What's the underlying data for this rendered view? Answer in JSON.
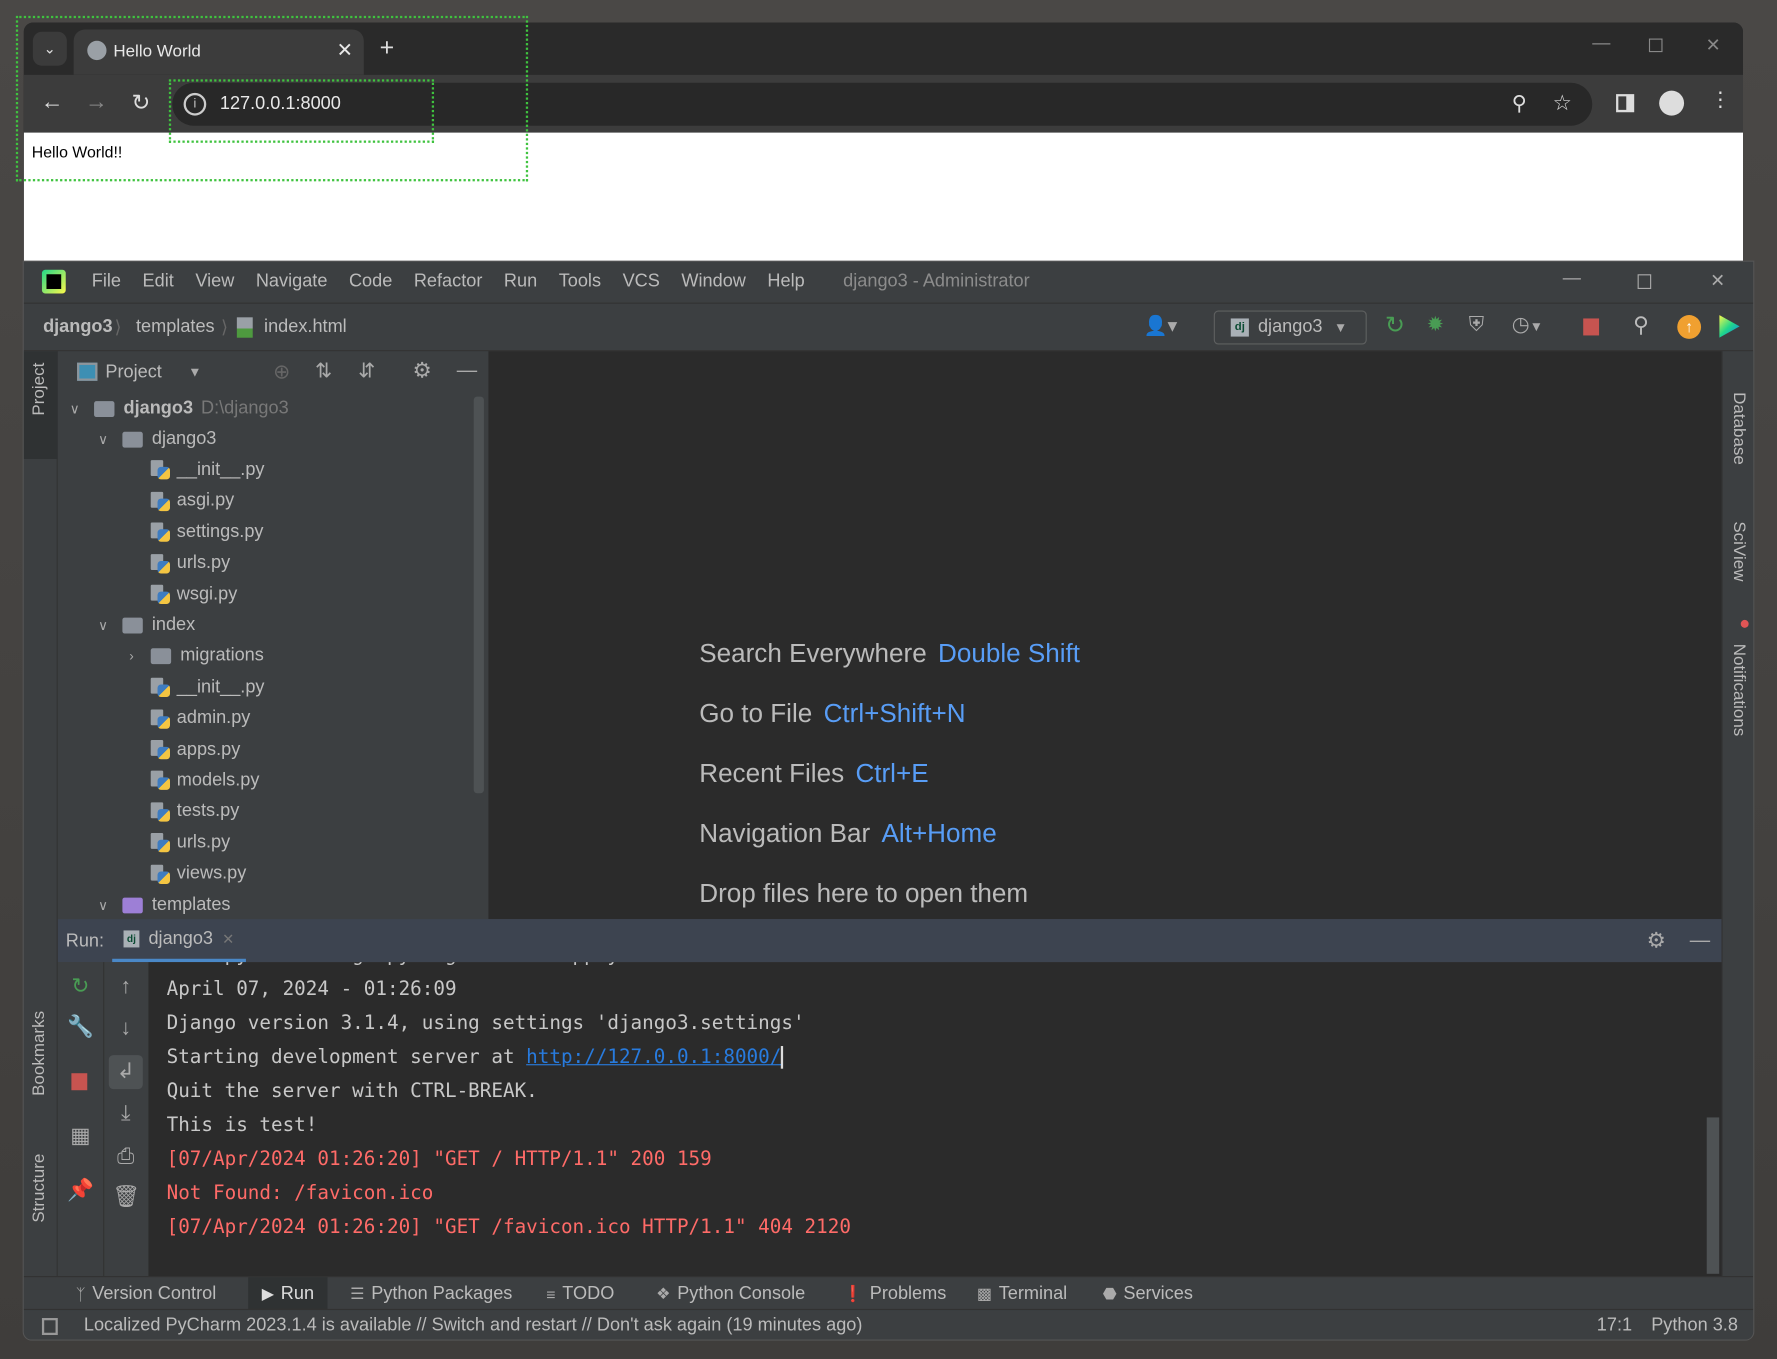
{
  "browser": {
    "tab_title": "Hello World",
    "url": "127.0.0.1:8000",
    "page_text": "Hello World!!"
  },
  "ide": {
    "menu": [
      "File",
      "Edit",
      "View",
      "Navigate",
      "Code",
      "Refactor",
      "Run",
      "Tools",
      "VCS",
      "Window",
      "Help"
    ],
    "window_title": "django3 - Administrator",
    "breadcrumb": [
      "django3",
      "templates",
      "index.html"
    ],
    "run_config": "django3",
    "project_panel": {
      "title": "Project",
      "root": {
        "name": "django3",
        "path": "D:\\django3"
      },
      "tree": [
        {
          "label": "django3",
          "type": "folder",
          "level": 1,
          "expanded": true
        },
        {
          "label": "__init__.py",
          "type": "py",
          "level": 2
        },
        {
          "label": "asgi.py",
          "type": "py",
          "level": 2
        },
        {
          "label": "settings.py",
          "type": "py",
          "level": 2
        },
        {
          "label": "urls.py",
          "type": "py",
          "level": 2
        },
        {
          "label": "wsgi.py",
          "type": "py",
          "level": 2
        },
        {
          "label": "index",
          "type": "folder",
          "level": 1,
          "expanded": true
        },
        {
          "label": "migrations",
          "type": "folder",
          "level": 2,
          "expanded": false
        },
        {
          "label": "__init__.py",
          "type": "py",
          "level": 2
        },
        {
          "label": "admin.py",
          "type": "py",
          "level": 2
        },
        {
          "label": "apps.py",
          "type": "py",
          "level": 2
        },
        {
          "label": "models.py",
          "type": "py",
          "level": 2
        },
        {
          "label": "tests.py",
          "type": "py",
          "level": 2
        },
        {
          "label": "urls.py",
          "type": "py",
          "level": 2
        },
        {
          "label": "views.py",
          "type": "py",
          "level": 2
        },
        {
          "label": "templates",
          "type": "folder-purple",
          "level": 1,
          "expanded": true
        }
      ]
    },
    "editor_hints": [
      {
        "label": "Search Everywhere",
        "key": "Double Shift"
      },
      {
        "label": "Go to File",
        "key": "Ctrl+Shift+N"
      },
      {
        "label": "Recent Files",
        "key": "Ctrl+E"
      },
      {
        "label": "Navigation Bar",
        "key": "Alt+Home"
      },
      {
        "label": "Drop files here to open them",
        "key": ""
      }
    ],
    "left_stripe": [
      "Project",
      "Bookmarks",
      "Structure"
    ],
    "right_stripe": [
      "Database",
      "SciView",
      "Notifications"
    ],
    "run_panel": {
      "label": "Run:",
      "tab": "django3",
      "console": [
        {
          "text": "Run 'python manage.py migrate' to apply them.",
          "color": "normal"
        },
        {
          "text": "April 07, 2024 - 01:26:09",
          "color": "normal"
        },
        {
          "text": "Django version 3.1.4, using settings 'django3.settings'",
          "color": "normal"
        },
        {
          "text": "Starting development server at ",
          "link": "http://127.0.0.1:8000/",
          "color": "normal"
        },
        {
          "text": "Quit the server with CTRL-BREAK.",
          "color": "normal"
        },
        {
          "text": "This is test!",
          "color": "normal"
        },
        {
          "text": "[07/Apr/2024 01:26:20] \"GET / HTTP/1.1\" 200 159",
          "color": "error"
        },
        {
          "text": "Not Found: /favicon.ico",
          "color": "error"
        },
        {
          "text": "[07/Apr/2024 01:26:20] \"GET /favicon.ico HTTP/1.1\" 404 2120",
          "color": "error"
        }
      ]
    },
    "bottom_tabs": [
      "Version Control",
      "Run",
      "Python Packages",
      "TODO",
      "Python Console",
      "Problems",
      "Terminal",
      "Services"
    ],
    "status": {
      "message": "Localized PyCharm 2023.1.4 is available // Switch and restart // Don't ask again (19 minutes ago)",
      "position": "17:1",
      "interpreter": "Python 3.8"
    }
  },
  "colors": {
    "accent": "#589df6",
    "link": "#287bde",
    "error": "#ff6b68",
    "run_green": "#499c54",
    "stop_red": "#c75450"
  }
}
